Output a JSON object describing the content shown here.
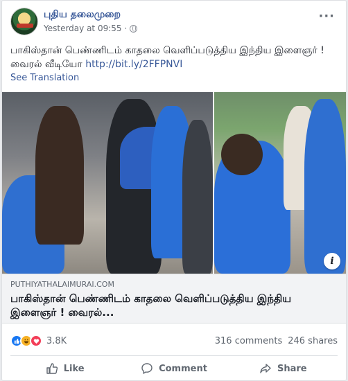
{
  "post": {
    "page_name": "புதிய தலைமுறை",
    "timestamp": "Yesterday at 09:55",
    "separator": "·",
    "more": "···",
    "text": "பாகிஸ்தான் பெண்ணிடம் காதலை வெளிப்படுத்திய இந்திய இளைஞர் ! வைரல் வீடியோ ",
    "link_text": "http://bit.ly/2FFPNVI",
    "see_translation": "See Translation"
  },
  "link_preview": {
    "domain": "PUTHIYATHALAIMURAI.COM",
    "title": "பாகிஸ்தான் பெண்ணிடம் காதலை வெளிப்படுத்திய இந்திய இளைஞர் ! வைரல்...",
    "info_glyph": "i"
  },
  "stats": {
    "reaction_count": "3.8K",
    "comments": "316 comments",
    "shares": "246 shares",
    "reaction_icons": [
      "like-icon",
      "haha-icon",
      "love-icon"
    ]
  },
  "actions": {
    "like": "Like",
    "comment": "Comment",
    "share": "Share"
  },
  "colors": {
    "link": "#385898",
    "like_blue": "#1877f2",
    "haha_yellow": "#f7b125",
    "love_red": "#f33e58"
  }
}
